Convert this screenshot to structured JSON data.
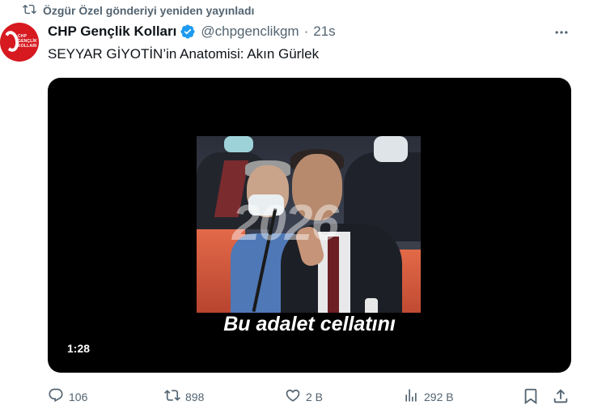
{
  "repost": {
    "text": "Özgür Özel gönderiyi yeniden yayınladı"
  },
  "author": {
    "display_name": "CHP Gençlik Kolları",
    "handle": "@chpgenclikgm",
    "separator": "·",
    "time": "21s",
    "avatar_text_lines": [
      "CHP",
      "GENÇLİK",
      "KOLLARI"
    ]
  },
  "tweet": {
    "text": "SEYYAR GİYOTİN’in Anatomisi: Akın Gürlek"
  },
  "media": {
    "caption": "Bu adalet cellatını",
    "watermark": "2026",
    "duration": "1:28"
  },
  "metrics": {
    "replies": "106",
    "reposts": "898",
    "likes": "2 B",
    "views": "292 B"
  },
  "colors": {
    "accent": "#1d9bf0",
    "muted": "#536471",
    "text": "#0f1419",
    "avatar_red": "#d71920"
  }
}
